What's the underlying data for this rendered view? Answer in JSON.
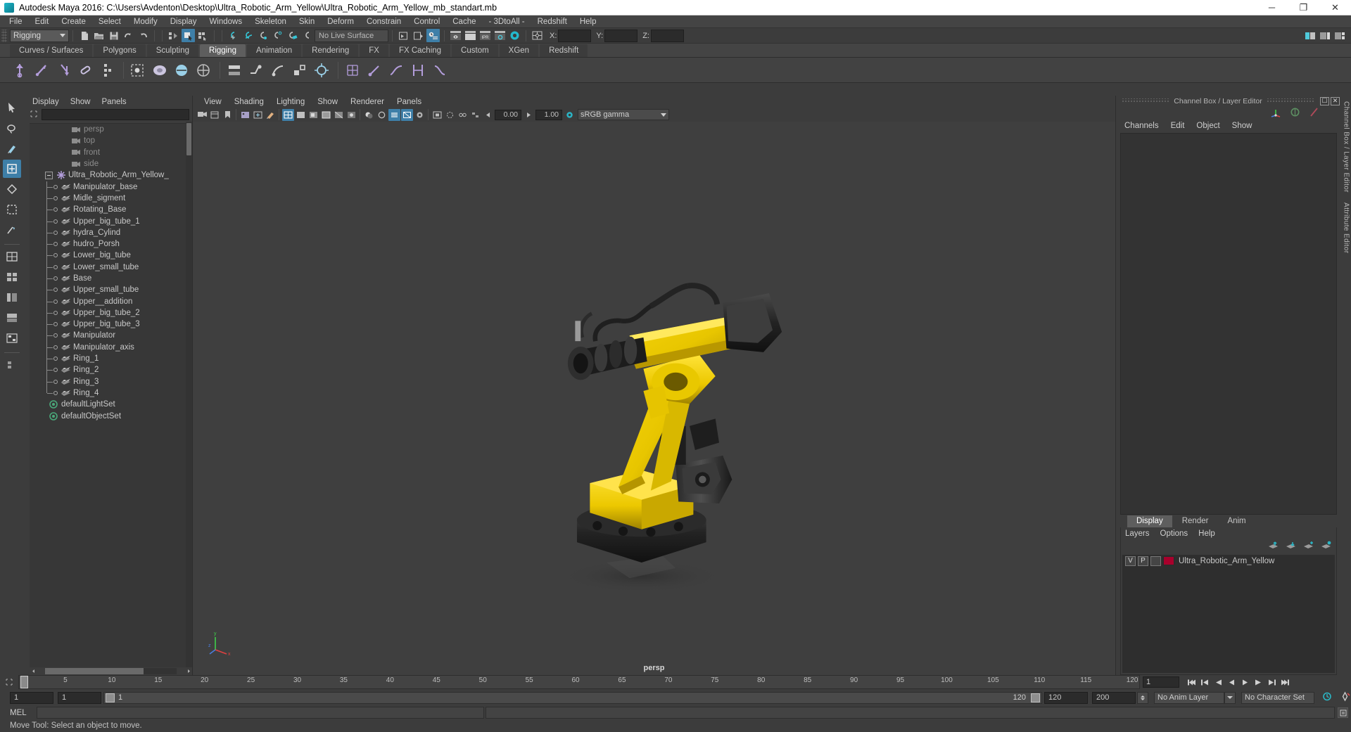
{
  "window": {
    "title": "Autodesk Maya 2016: C:\\Users\\Avdenton\\Desktop\\Ultra_Robotic_Arm_Yellow\\Ultra_Robotic_Arm_Yellow_mb_standart.mb",
    "minimize": "─",
    "maximize": "❐",
    "close": "✕"
  },
  "menubar": {
    "items": [
      "File",
      "Edit",
      "Create",
      "Select",
      "Modify",
      "Display",
      "Windows",
      "Skeleton",
      "Skin",
      "Deform",
      "Constrain",
      "Control",
      "Cache",
      "- 3DtoAll -",
      "Redshift",
      "Help"
    ]
  },
  "statusline": {
    "menuset": "Rigging",
    "live_surface": "No Live Surface",
    "x_label": "X:",
    "y_label": "Y:",
    "z_label": "Z:",
    "x_value": "",
    "y_value": "",
    "z_value": ""
  },
  "shelf": {
    "tabs": [
      "Curves / Surfaces",
      "Polygons",
      "Sculpting",
      "Rigging",
      "Animation",
      "Rendering",
      "FX",
      "FX Caching",
      "Custom",
      "XGen",
      "Redshift"
    ],
    "active_tab": "Rigging"
  },
  "outliner": {
    "menu": [
      "Display",
      "Show",
      "Panels"
    ],
    "search_value": "",
    "cameras": [
      "persp",
      "top",
      "front",
      "side"
    ],
    "group": "Ultra_Robotic_Arm_Yellow_",
    "children": [
      "Manipulator_base",
      "Midle_sigment",
      "Rotating_Base",
      "Upper_big_tube_1",
      "hydra_Cylind",
      "hudro_Porsh",
      "Lower_big_tube",
      "Lower_small_tube",
      "Base",
      "Upper_small_tube",
      "Upper__addition",
      "Upper_big_tube_2",
      "Upper_big_tube_3",
      "Manipulator",
      "Manipulator_axis",
      "Ring_1",
      "Ring_2",
      "Ring_3",
      "Ring_4"
    ],
    "sets": [
      "defaultLightSet",
      "defaultObjectSet"
    ]
  },
  "viewport": {
    "menu": [
      "View",
      "Shading",
      "Lighting",
      "Show",
      "Renderer",
      "Panels"
    ],
    "exposure": "0.00",
    "gamma": "1.00",
    "color_profile": "sRGB gamma",
    "camera_label": "persp",
    "axis_x": "x",
    "axis_y": "y",
    "axis_z": "z"
  },
  "channelbox": {
    "title": "Channel Box / Layer Editor",
    "menu": [
      "Channels",
      "Edit",
      "Object",
      "Show"
    ],
    "side_tabs": [
      "Channel Box / Layer Editor",
      "Attribute Editor"
    ]
  },
  "layer_editor": {
    "tabs": [
      "Display",
      "Render",
      "Anim"
    ],
    "active_tab": "Display",
    "menu": [
      "Layers",
      "Options",
      "Help"
    ],
    "layers": [
      {
        "visibility": "V",
        "playback": "P",
        "shading": "",
        "color": "#a8002c",
        "name": "Ultra_Robotic_Arm_Yellow"
      }
    ]
  },
  "timeline": {
    "ticks": [
      "5",
      "10",
      "15",
      "20",
      "25",
      "30",
      "35",
      "40",
      "45",
      "50",
      "55",
      "60",
      "65",
      "70",
      "75",
      "80",
      "85",
      "90",
      "95",
      "100",
      "105",
      "110",
      "115",
      "120"
    ],
    "current_frame": "1",
    "current_frame_field": "1",
    "range_start": "1",
    "range_start2": "1",
    "range_bar_start": "1",
    "range_bar_end": "120",
    "range_end": "120",
    "playback_end": "200",
    "anim_layer": "No Anim Layer",
    "character_set": "No Character Set"
  },
  "command_line": {
    "label": "MEL",
    "input_value": "",
    "output_value": ""
  },
  "help_line": {
    "text": "Move Tool: Select an object to move."
  },
  "colors": {
    "accent_blue": "#3e7fa8",
    "bg": "#3c3c3c",
    "panel": "#373737",
    "teal": "#2bb5c4",
    "layer_red": "#a8002c"
  }
}
